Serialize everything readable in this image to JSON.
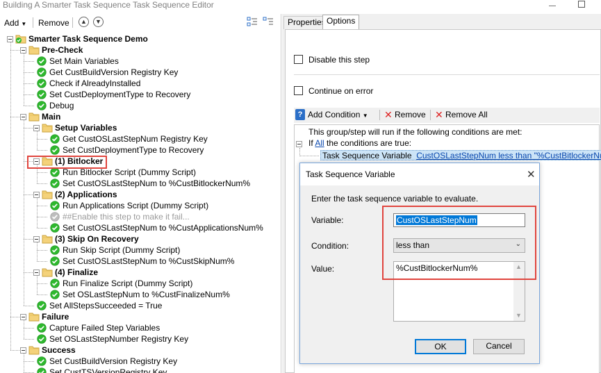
{
  "window": {
    "title": "Building A Smarter Task Sequence Task Sequence Editor"
  },
  "toolbar": {
    "add_label": "Add",
    "remove_label": "Remove"
  },
  "tree": {
    "root": "Smarter Task Sequence Demo",
    "pre_check": {
      "label": "Pre-Check",
      "items": [
        "Set Main Variables",
        "Get CustBuildVersion Registry Key",
        "Check if AlreadyInstalled",
        "Set CustDeploymentType to Recovery",
        "Debug"
      ]
    },
    "main": {
      "label": "Main",
      "setup": {
        "label": "Setup Variables",
        "items": [
          "Get CustOSLastStepNum Registry Key",
          "Set CustDeploymentType to Recovery"
        ]
      },
      "bitlocker": {
        "label": "(1) Bitlocker",
        "items": [
          "Run Bitlocker Script (Dummy Script)",
          "Set CustOSLastStepNum to %CustBitlockerNum%"
        ]
      },
      "applications": {
        "label": "(2) Applications",
        "items": [
          "Run Applications Script (Dummy Script)",
          "##Enable this step to make it fail...",
          "Set CustOSLastStepNum to %CustApplicationsNum%"
        ]
      },
      "skip": {
        "label": "(3) Skip On Recovery",
        "items": [
          "Run Skip Script (Dummy Script)",
          "Set CustOSLastStepNum to %CustSkipNum%"
        ]
      },
      "finalize": {
        "label": "(4) Finalize",
        "items": [
          "Run Finalize Script (Dummy Script)",
          "Set OSLastStepNum to %CustFinalizeNum%"
        ]
      },
      "last_item": "Set AllStepsSucceeded = True"
    },
    "failure": {
      "label": "Failure",
      "items": [
        "Capture Failed Step Variables",
        "Set OSLastStepNumber Registry Key"
      ]
    },
    "success": {
      "label": "Success",
      "items": [
        "Set CustBuildVersion Registry Key",
        "Set CustTSVersionRegistry Key"
      ]
    }
  },
  "tabs": {
    "properties": "Properties",
    "options": "Options"
  },
  "options": {
    "disable_step": "Disable this step",
    "continue_on_error": "Continue on error",
    "add_condition": "Add Condition",
    "remove": "Remove",
    "remove_all": "Remove All",
    "intro": "This group/step will run if the following conditions are met:",
    "if_word": "If",
    "all_link": "All",
    "if_suffix": "the conditions are true:",
    "cond_prefix": "Task Sequence Variable",
    "cond_link": "CustOSLastStepNum less than \"%CustBitlockerNum%\""
  },
  "dialog": {
    "title": "Task Sequence Variable",
    "prompt": "Enter the task sequence variable to evaluate.",
    "variable_label": "Variable:",
    "variable_value": "CustOSLastStepNum",
    "condition_label": "Condition:",
    "condition_value": "less than",
    "value_label": "Value:",
    "value_value": "%CustBitlockerNum%",
    "ok": "OK",
    "cancel": "Cancel"
  },
  "colors": {
    "highlight_box": "#e0443d",
    "selection": "#0078d7",
    "link": "#0645ad",
    "check_green": "#2eb82e"
  }
}
